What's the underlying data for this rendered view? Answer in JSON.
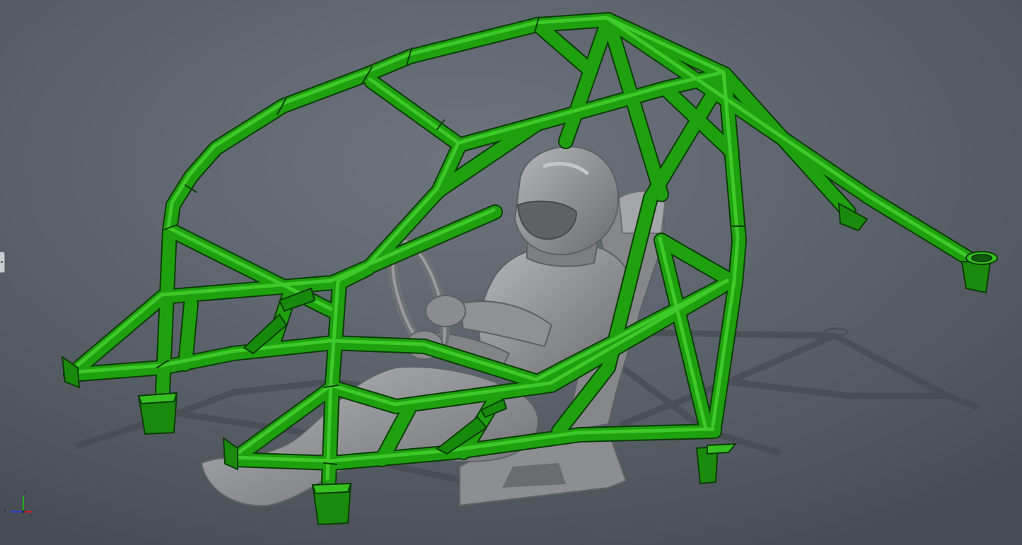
{
  "app": {
    "title": ""
  },
  "model": {
    "assembly": "roll cage",
    "tube_color": "#1fa00f",
    "tube_highlight": "#3fcf2a",
    "tube_shade": "#0f5a08",
    "scan_color": "#8f9194",
    "background": "#5a6069"
  },
  "triad": {
    "x_label": "X",
    "y_label": "Y",
    "z_label": "Z"
  }
}
